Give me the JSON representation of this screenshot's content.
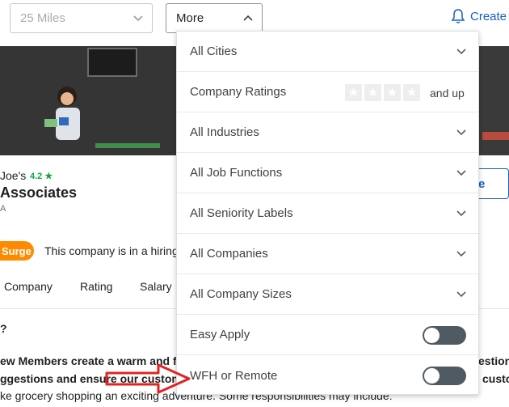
{
  "filters": {
    "distance": "25 Miles",
    "more": "More",
    "create_alert": "Create"
  },
  "company": {
    "short_name": "Joe's",
    "rating": "4.2 ★",
    "name": "Associates",
    "location": "A",
    "follow_label": "e",
    "surge_badge": "Surge",
    "surge_text": "This company is in a hiring"
  },
  "tabs": [
    "Company",
    "Rating",
    "Salary"
  ],
  "body": {
    "question": "?",
    "line1": "ew Members create a warm and fr",
    "line1_right": "estion",
    "line2": "ggestions and ensure our custom",
    "line2_right": "custo",
    "line3": "ke grocery shopping an exciting adventure. Some responsibilities may include:"
  },
  "dropdown": {
    "rows": [
      {
        "label": "All Cities",
        "type": "select"
      },
      {
        "label": "Company Ratings",
        "type": "rating",
        "suffix": "and up",
        "stars": 0
      },
      {
        "label": "All Industries",
        "type": "select"
      },
      {
        "label": "All Job Functions",
        "type": "select"
      },
      {
        "label": "All Seniority Labels",
        "type": "select"
      },
      {
        "label": "All Companies",
        "type": "select"
      },
      {
        "label": "All Company Sizes",
        "type": "select"
      },
      {
        "label": "Easy Apply",
        "type": "toggle",
        "on": false
      },
      {
        "label": "WFH or Remote",
        "type": "toggle",
        "on": false
      }
    ]
  },
  "colors": {
    "link": "#1861bf",
    "rating_green": "#0caa41",
    "surge_orange": "#ff8a00",
    "toggle_off": "#505a63",
    "arrow_red": "#e02424"
  }
}
